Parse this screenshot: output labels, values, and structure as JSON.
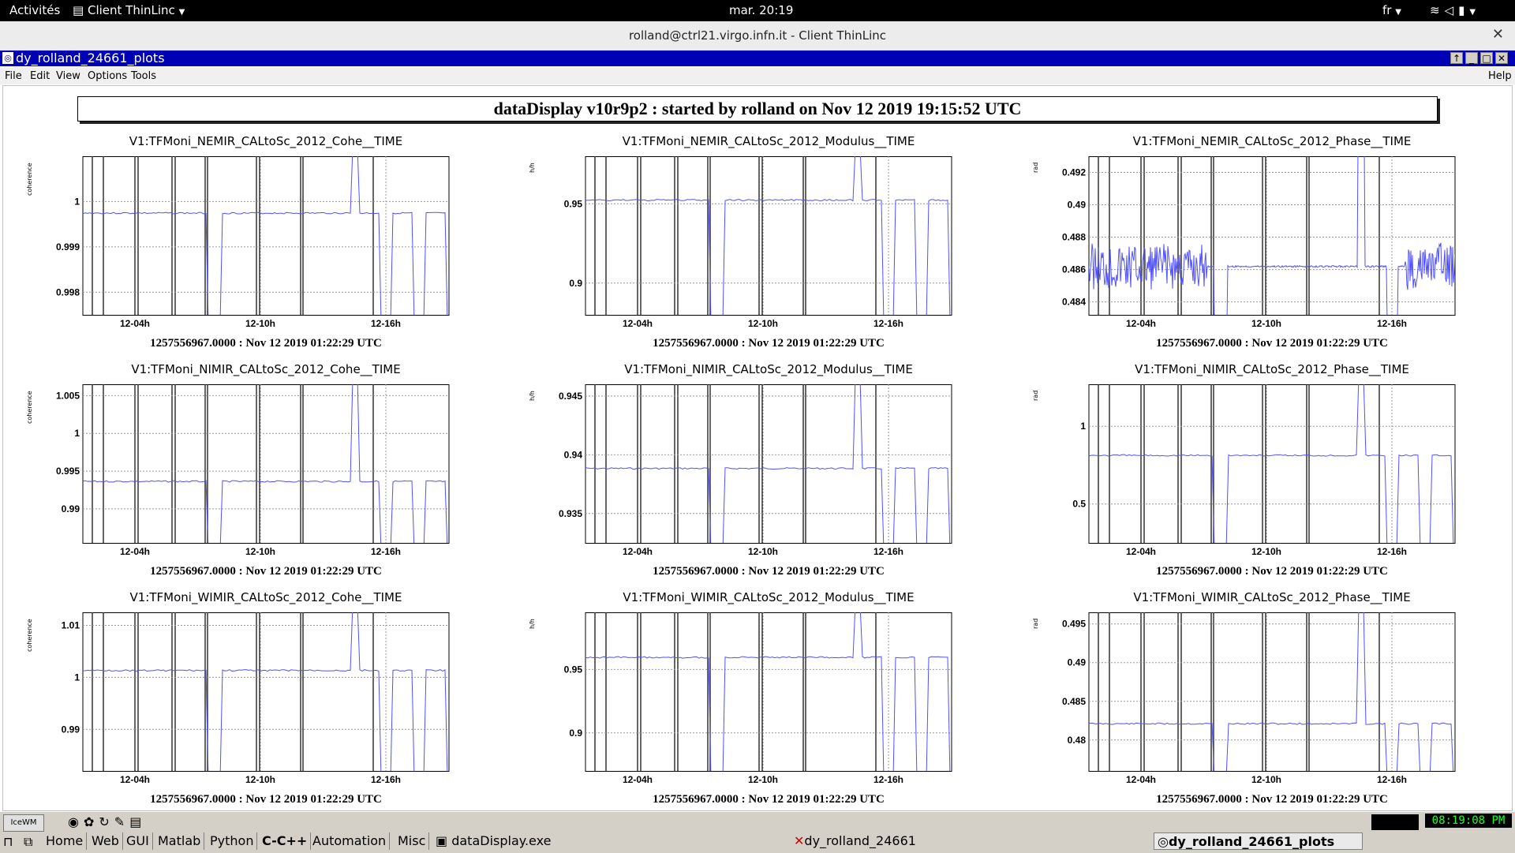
{
  "topbar": {
    "activities": "Activités",
    "app_menu": "Client ThinLinc",
    "clock": "mar. 20:19",
    "lang": "fr"
  },
  "thinlinc": {
    "title": "rolland@ctrl21.virgo.infn.it - Client ThinLinc"
  },
  "xwindow": {
    "title": "dy_rolland_24661_plots"
  },
  "menus": {
    "file": "File",
    "edit": "Edit",
    "view": "View",
    "options": "Options",
    "tools": "Tools",
    "help": "Help"
  },
  "banner": "dataDisplay v10r9p2 : started by rolland on Nov 12 2019 19:15:52 UTC",
  "plots": [
    {
      "title": "V1:TFMoni_NEMIR_CALtoSc_2012_Cohe__TIME",
      "ylabel": "coherence",
      "yticks": [
        "1",
        "0.999",
        "0.998"
      ],
      "ymin": 0.9975,
      "ymax": 1.001,
      "footer": "1257556967.0000 : Nov 12 2019 01:22:29 UTC"
    },
    {
      "title": "V1:TFMoni_NEMIR_CALtoSc_2012_Modulus__TIME",
      "ylabel": "h/h",
      "yticks": [
        "0.95",
        "0.9"
      ],
      "ymin": 0.88,
      "ymax": 0.98,
      "footer": "1257556967.0000 : Nov 12 2019 01:22:29 UTC"
    },
    {
      "title": "V1:TFMoni_NEMIR_CALtoSc_2012_Phase__TIME",
      "ylabel": "rad",
      "yticks": [
        "0.492",
        "0.49",
        "0.488",
        "0.486",
        "0.484"
      ],
      "ymin": 0.4832,
      "ymax": 0.493,
      "footer": "1257556967.0000 : Nov 12 2019 01:22:29 UTC"
    },
    {
      "title": "V1:TFMoni_NIMIR_CALtoSc_2012_Cohe__TIME",
      "ylabel": "coherence",
      "yticks": [
        "1.005",
        "1",
        "0.995",
        "0.99"
      ],
      "ymin": 0.9855,
      "ymax": 1.0065,
      "footer": "1257556967.0000 : Nov 12 2019 01:22:29 UTC"
    },
    {
      "title": "V1:TFMoni_NIMIR_CALtoSc_2012_Modulus__TIME",
      "ylabel": "h/h",
      "yticks": [
        "0.945",
        "0.94",
        "0.935"
      ],
      "ymin": 0.9325,
      "ymax": 0.946,
      "footer": "1257556967.0000 : Nov 12 2019 01:22:29 UTC"
    },
    {
      "title": "V1:TFMoni_NIMIR_CALtoSc_2012_Phase__TIME",
      "ylabel": "rad",
      "yticks": [
        "1",
        "0.5"
      ],
      "ymin": 0.25,
      "ymax": 1.27,
      "footer": "1257556967.0000 : Nov 12 2019 01:22:29 UTC"
    },
    {
      "title": "V1:TFMoni_WIMIR_CALtoSc_2012_Cohe__TIME",
      "ylabel": "coherence",
      "yticks": [
        "1.01",
        "1",
        "0.99"
      ],
      "ymin": 0.982,
      "ymax": 1.0125,
      "footer": "1257556967.0000 : Nov 12 2019 01:22:29 UTC"
    },
    {
      "title": "V1:TFMoni_WIMIR_CALtoSc_2012_Modulus__TIME",
      "ylabel": "h/h",
      "yticks": [
        "0.95",
        "0.9"
      ],
      "ymin": 0.87,
      "ymax": 0.995,
      "footer": "1257556967.0000 : Nov 12 2019 01:22:29 UTC"
    },
    {
      "title": "V1:TFMoni_WIMIR_CALtoSc_2012_Phase__TIME",
      "ylabel": "rad",
      "yticks": [
        "0.495",
        "0.49",
        "0.485",
        "0.48"
      ],
      "ymin": 0.476,
      "ymax": 0.4965,
      "footer": "1257556967.0000 : Nov 12 2019 01:22:29 UTC"
    }
  ],
  "xticks": [
    "12-04h",
    "12-10h",
    "12-16h"
  ],
  "taskbar": {
    "buttons": [
      "Home",
      "Web",
      "GUI",
      "Matlab",
      "Python",
      "C-C++",
      "Automation",
      "Misc"
    ],
    "windows": [
      "dataDisplay.exe",
      "dy_rolland_24661",
      "dy_rolland_24661_plots"
    ],
    "clock": "08:19:08 PM"
  },
  "colors": {
    "trace": "#5050ff",
    "titlebar": "#0000b4"
  }
}
